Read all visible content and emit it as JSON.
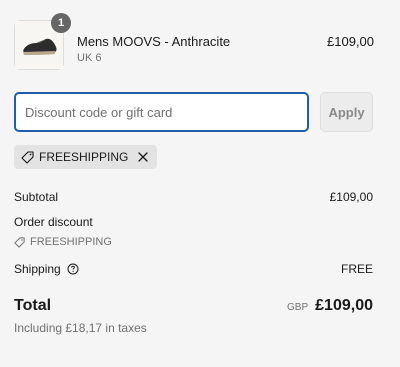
{
  "product": {
    "quantity": "1",
    "name": "Mens MOOVS - Anthracite",
    "variant": "UK 6",
    "price": "£109,00",
    "image_icon": "shoe-icon"
  },
  "discount": {
    "placeholder": "Discount code or gift card",
    "value": "",
    "apply_label": "Apply"
  },
  "applied_code": {
    "code": "FREESHIPPING",
    "tag_icon": "tag-icon",
    "remove_icon": "close-icon"
  },
  "summary": {
    "subtotal_label": "Subtotal",
    "subtotal_value": "£109,00",
    "order_discount_label": "Order discount",
    "order_discount_code": "FREESHIPPING",
    "shipping_label": "Shipping",
    "shipping_value": "FREE",
    "help_icon": "question-circle-icon"
  },
  "total": {
    "label": "Total",
    "currency": "GBP",
    "amount": "£109,00",
    "taxes_note": "Including £18,17 in taxes"
  },
  "colors": {
    "input_focus_border": "#1f5fa6",
    "badge_bg": "#666666",
    "chip_bg": "#e3e3e3"
  }
}
